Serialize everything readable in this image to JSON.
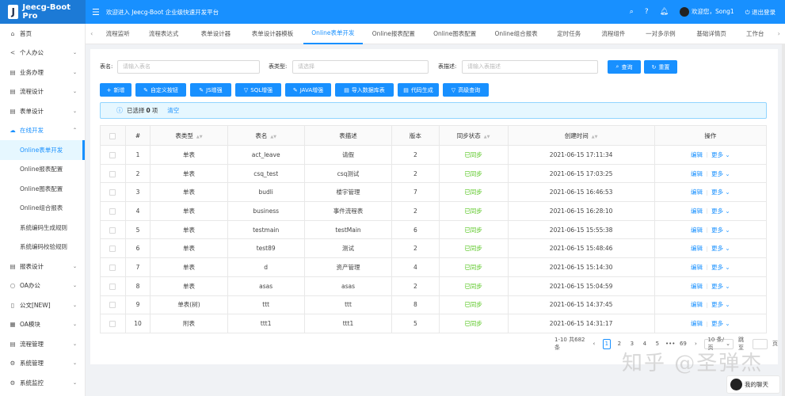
{
  "app": {
    "logo_letter": "J",
    "title": "Jeecg-Boot Pro",
    "welcome": "欢迎进入 Jeecg-Boot 企业级快速开发平台"
  },
  "header": {
    "user_greeting": "欢迎您，Song1",
    "logout": "退出登录"
  },
  "sidebar": {
    "items": [
      {
        "label": "首页",
        "icon": "home-icon",
        "glyph": "⌂",
        "arrow": ""
      },
      {
        "label": "个人办公",
        "icon": "share-icon",
        "glyph": "<",
        "arrow": "⌄"
      },
      {
        "label": "业务办理",
        "icon": "table-icon",
        "glyph": "▤",
        "arrow": "⌄"
      },
      {
        "label": "流程设计",
        "icon": "table-icon",
        "glyph": "▤",
        "arrow": "⌄"
      },
      {
        "label": "表单设计",
        "icon": "table-icon",
        "glyph": "▤",
        "arrow": "⌄"
      },
      {
        "label": "在线开发",
        "icon": "cloud-icon",
        "glyph": "☁",
        "arrow": "⌃",
        "active_parent": true
      },
      {
        "label": "Online表单开发",
        "sub": true,
        "active": true
      },
      {
        "label": "Online报表配置",
        "sub": true
      },
      {
        "label": "Online图表配置",
        "sub": true
      },
      {
        "label": "Online组合报表",
        "sub": true
      },
      {
        "label": "系统编码生成规则",
        "sub": true
      },
      {
        "label": "系统编码校验规则",
        "sub": true
      },
      {
        "label": "报表设计",
        "icon": "table-icon",
        "glyph": "▤",
        "arrow": "⌄"
      },
      {
        "label": "OA办公",
        "icon": "search-icon",
        "glyph": "○",
        "arrow": "⌄"
      },
      {
        "label": "公文[NEW]",
        "icon": "file-icon",
        "glyph": "▯",
        "arrow": "⌄"
      },
      {
        "label": "OA模块",
        "icon": "grid-icon",
        "glyph": "▦",
        "arrow": "⌄"
      },
      {
        "label": "流程管理",
        "icon": "table-icon",
        "glyph": "▤",
        "arrow": "⌄"
      },
      {
        "label": "系统管理",
        "icon": "gear-icon",
        "glyph": "⚙",
        "arrow": "⌄"
      },
      {
        "label": "系统监控",
        "icon": "monitor-icon",
        "glyph": "⚙",
        "arrow": "⌄"
      }
    ]
  },
  "tabs": [
    {
      "label": "流程监听",
      "w": 52
    },
    {
      "label": "流程表达式",
      "w": 68
    },
    {
      "label": "表单设计器",
      "w": 68
    },
    {
      "label": "表单设计器模板",
      "w": 80
    },
    {
      "label": "Online表单开发",
      "w": 78,
      "active": true
    },
    {
      "label": "Online报表配置",
      "w": 80
    },
    {
      "label": "Online图表配置",
      "w": 80
    },
    {
      "label": "Online组合报表",
      "w": 80
    },
    {
      "label": "定时任务",
      "w": 58
    },
    {
      "label": "流程组件",
      "w": 58
    },
    {
      "label": "一对多示例",
      "w": 65
    },
    {
      "label": "基础详情页",
      "w": 68
    },
    {
      "label": "工作台",
      "w": 46
    }
  ],
  "search": {
    "table_name_label": "表名:",
    "table_name_placeholder": "请输入表名",
    "table_type_label": "表类型:",
    "table_type_placeholder": "请选择",
    "table_desc_label": "表描述:",
    "table_desc_placeholder": "请输入表描述",
    "query_label": "查询",
    "reset_label": "重置"
  },
  "toolbar": [
    {
      "label": "新增",
      "glyph": "+",
      "name": "add-button"
    },
    {
      "label": "自定义按钮",
      "glyph": "✎",
      "name": "custom-button-button"
    },
    {
      "label": "JS增强",
      "glyph": "✎",
      "name": "js-enhance-button"
    },
    {
      "label": "SQL增强",
      "glyph": "▽",
      "name": "sql-enhance-button"
    },
    {
      "label": "JAVA增强",
      "glyph": "✎",
      "name": "java-enhance-button"
    },
    {
      "label": "导入数据库表",
      "glyph": "▤",
      "name": "import-db-table-button"
    },
    {
      "label": "代码生成",
      "glyph": "▤",
      "name": "code-gen-button"
    },
    {
      "label": "高级查询",
      "glyph": "▽",
      "name": "advanced-query-button"
    }
  ],
  "alert": {
    "prefix": "已选择",
    "count": "0",
    "suffix": "项",
    "clear": "清空"
  },
  "table": {
    "headers": [
      "#",
      "表类型",
      "表名",
      "表描述",
      "版本",
      "同步状态",
      "创建时间",
      "操作"
    ],
    "rows": [
      {
        "no": "1",
        "type": "单表",
        "name": "act_leave",
        "desc": "请假",
        "version": "2",
        "sync": "已同步",
        "time": "2021-06-15 17:11:34"
      },
      {
        "no": "2",
        "type": "单表",
        "name": "csq_test",
        "desc": "csq测试",
        "version": "2",
        "sync": "已同步",
        "time": "2021-06-15 17:03:25"
      },
      {
        "no": "3",
        "type": "单表",
        "name": "budli",
        "desc": "楼宇管理",
        "version": "7",
        "sync": "已同步",
        "time": "2021-06-15 16:46:53"
      },
      {
        "no": "4",
        "type": "单表",
        "name": "business",
        "desc": "事件流程表",
        "version": "2",
        "sync": "已同步",
        "time": "2021-06-15 16:28:10"
      },
      {
        "no": "5",
        "type": "单表",
        "name": "testmain",
        "desc": "testMain",
        "version": "6",
        "sync": "已同步",
        "time": "2021-06-15 15:55:38"
      },
      {
        "no": "6",
        "type": "单表",
        "name": "test89",
        "desc": "测试",
        "version": "2",
        "sync": "已同步",
        "time": "2021-06-15 15:48:46"
      },
      {
        "no": "7",
        "type": "单表",
        "name": "d",
        "desc": "资产管理",
        "version": "4",
        "sync": "已同步",
        "time": "2021-06-15 15:14:30"
      },
      {
        "no": "8",
        "type": "单表",
        "name": "asas",
        "desc": "asas",
        "version": "2",
        "sync": "已同步",
        "time": "2021-06-15 15:04:59"
      },
      {
        "no": "9",
        "type": "单表(树)",
        "name": "ttt",
        "desc": "ttt",
        "version": "8",
        "sync": "已同步",
        "time": "2021-06-15 14:37:45"
      },
      {
        "no": "10",
        "type": "附表",
        "name": "ttt1",
        "desc": "ttt1",
        "version": "5",
        "sync": "已同步",
        "time": "2021-06-15 14:31:17"
      }
    ],
    "edit_label": "编辑",
    "more_label": "更多"
  },
  "pager": {
    "summary": "1-10 共682条",
    "pages": [
      "1",
      "2",
      "3",
      "4",
      "5",
      "•••",
      "69"
    ],
    "current": "1",
    "size": "10 条/页",
    "jump": "跳至",
    "page_unit": "页"
  },
  "watermark": "知乎 @圣弹杰",
  "chat": {
    "label": "我的聊天"
  }
}
